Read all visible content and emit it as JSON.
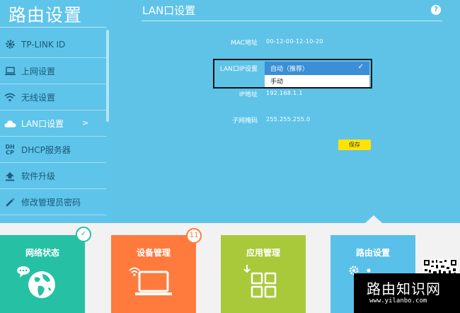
{
  "sidebar": {
    "title": "路由设置",
    "items": [
      {
        "label": "TP-LINK ID",
        "icon": "gear-icon"
      },
      {
        "label": "上网设置",
        "icon": "laptop-icon"
      },
      {
        "label": "无线设置",
        "icon": "wifi-icon"
      },
      {
        "label": "LAN口设置",
        "icon": "cloud-icon",
        "arrow": ">"
      },
      {
        "label": "DHCP服务器",
        "icon": "dhcp-icon",
        "icon_text": "DH CP"
      },
      {
        "label": "软件升级",
        "icon": "upload-icon"
      },
      {
        "label": "修改管理员密码",
        "icon": "pencil-icon"
      }
    ]
  },
  "panel": {
    "title": "LAN口设置",
    "help": "?",
    "mac_label": "MAC地址",
    "mac_value": "00-12-00-12-10-20",
    "lan_ip_label": "LAN口IP设置",
    "lan_ip_selected": "自动（推荐）",
    "lan_ip_option": "手动",
    "ip_label": "IP地址",
    "ip_value": "192.168.1.1",
    "mask_label": "子网掩码",
    "mask_value": "255.255.255.0",
    "save_label": "保存"
  },
  "tiles": [
    {
      "label": "网络状态",
      "badge": "✓"
    },
    {
      "label": "设备管理",
      "badge": "11"
    },
    {
      "label": "应用管理"
    },
    {
      "label": "路由设置"
    }
  ],
  "watermark": {
    "text": "路由知识网",
    "url": "www.yilanbo.com"
  },
  "colors": {
    "background": "#5fc3e8",
    "tile_network": "#26c0a5",
    "tile_devices": "#ff7a3d",
    "tile_apps": "#a9c93a",
    "tile_router": "#59c0e9",
    "save_button": "#ffe400",
    "select_bg": "#3a8fd6"
  }
}
